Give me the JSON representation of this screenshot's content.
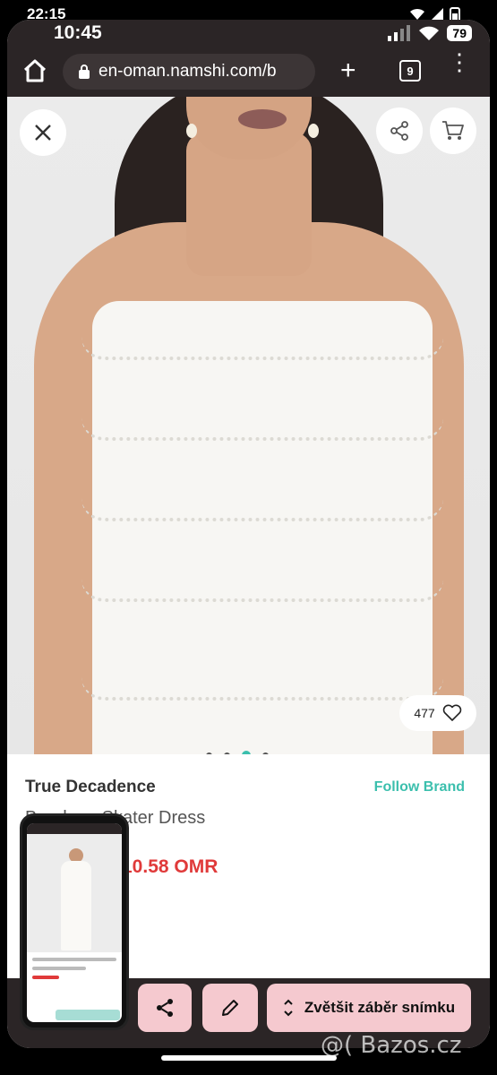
{
  "outer_status": {
    "time": "22:15"
  },
  "inner_status": {
    "time": "10:45",
    "battery": "79"
  },
  "browser": {
    "url": "en-oman.namshi.com/b",
    "tab_count": "9"
  },
  "hero": {
    "likes": "477",
    "carousel": {
      "total": 4,
      "active_index": 2
    },
    "icons": {
      "close": "close-icon",
      "share": "share-icon",
      "cart": "cart-icon",
      "heart": "heart-icon"
    }
  },
  "product": {
    "brand": "True Decadence",
    "follow_label": "Follow Brand",
    "name": "Bandeau Skater Dress",
    "price": "10.58 OMR"
  },
  "actions": {
    "zoom_label": "Zvětšit záběr snímku"
  },
  "watermark": "@( Bazos.cz",
  "colors": {
    "accent": "#3bbfad",
    "price": "#e03a3a",
    "action_button": "#f5c9cf",
    "chrome": "#2b2526"
  }
}
